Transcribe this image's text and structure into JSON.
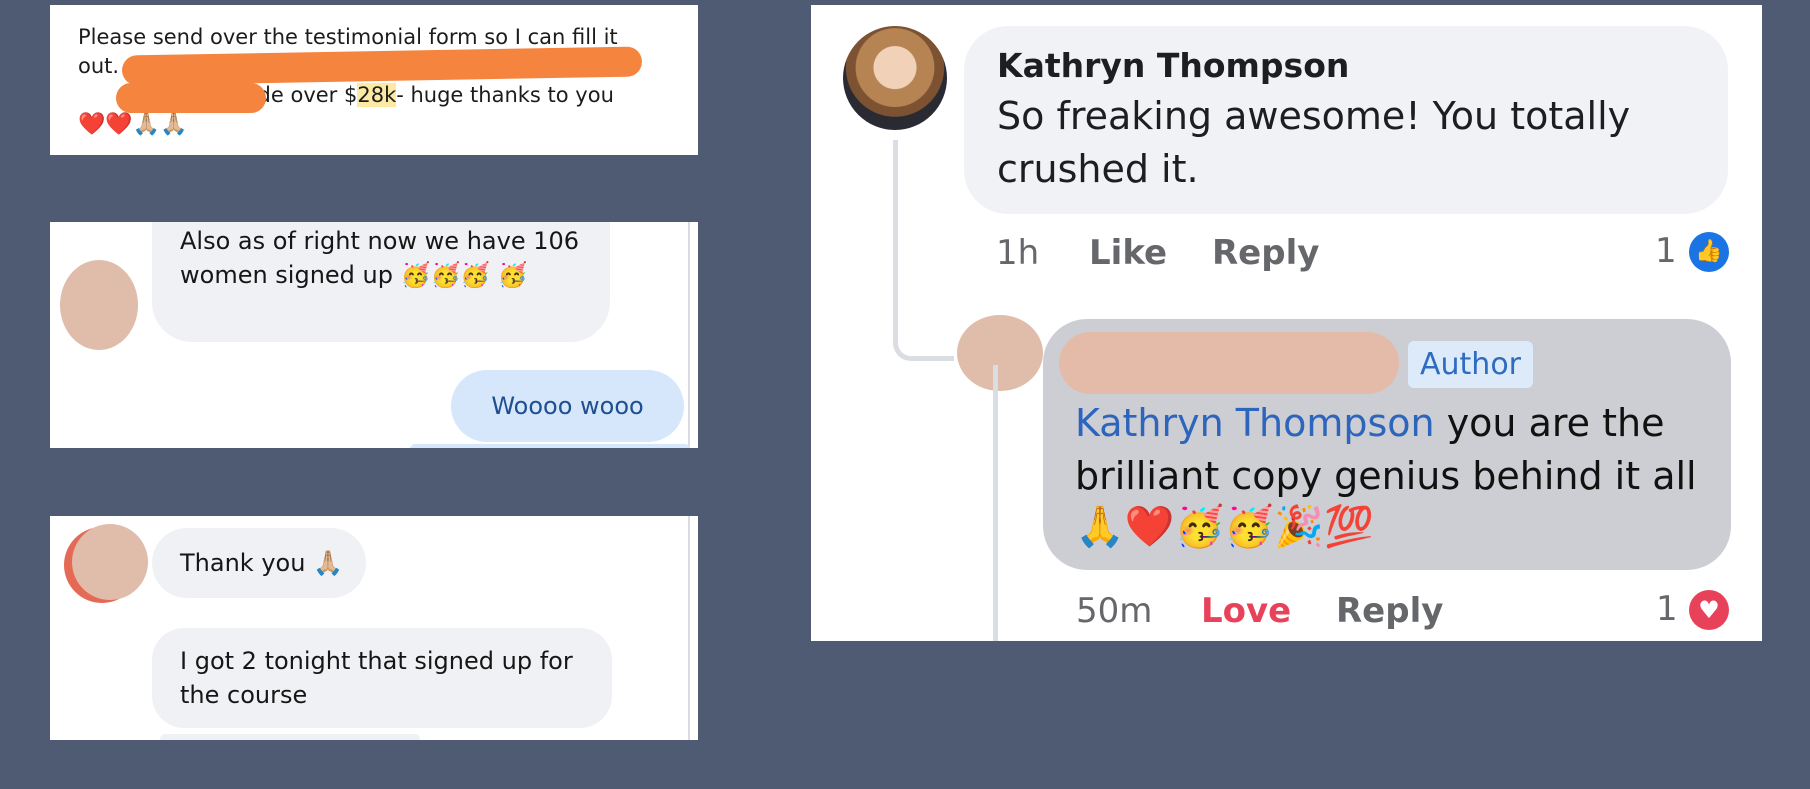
{
  "email_card": {
    "line1": "Please send over the testimonial form so I can fill it",
    "line2": "out.",
    "line3_prefix": ". I made over $",
    "highlight": "28k",
    "line3_suffix": "- huge thanks to you",
    "emoji_row": "❤️❤️🙏🏼🙏🏼"
  },
  "messenger_card_1": {
    "incoming_text": "Also as of right now we have 106 women signed up 🥳🥳🥳 🥳",
    "outgoing_text": "Woooo wooo"
  },
  "messenger_card_2": {
    "bubble1_text": "Thank you 🙏🏼",
    "bubble2_text": "I got 2 tonight that signed up for the course"
  },
  "facebook_card": {
    "comment": {
      "author": "Kathryn Thompson",
      "text": "So freaking awesome! You totally crushed it.",
      "time": "1h",
      "like_label": "Like",
      "reply_label": "Reply",
      "reaction_count": "1"
    },
    "reply": {
      "badge": "Author",
      "mention": "Kathryn Thompson",
      "text": " you are the brilliant copy genius behind it all",
      "emojis": "🙏❤️🥳🥳🎉💯",
      "time": "50m",
      "love_label": "Love",
      "reply_label": "Reply",
      "reaction_count": "1"
    }
  },
  "colors": {
    "background": "#4f5a73",
    "scribble": "#f5843f",
    "fb_blue": "#1b74e4",
    "love_red": "#e8425a"
  }
}
